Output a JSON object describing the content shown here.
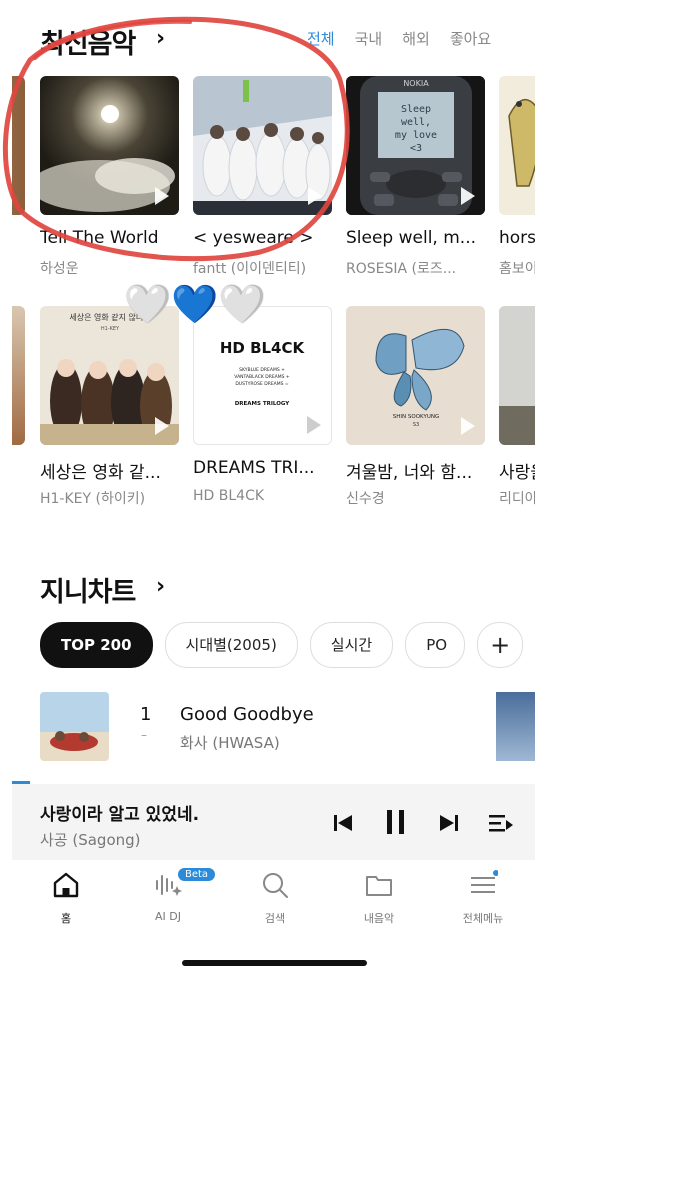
{
  "new_music": {
    "title": "최신음악",
    "tabs": [
      {
        "label": "전체",
        "active": true
      },
      {
        "label": "국내",
        "active": false
      },
      {
        "label": "해외",
        "active": false
      },
      {
        "label": "좋아요",
        "active": false
      }
    ],
    "row1": [
      {
        "title": "Tell The World",
        "artist": "하성운"
      },
      {
        "title": "< yesweare >",
        "artist": "fantt (이이덴티티)"
      },
      {
        "title": "Sleep well, m...",
        "artist": "ROSESIA (로즈..."
      },
      {
        "title": "hors",
        "artist": "홈보이"
      }
    ],
    "row2": [
      {
        "title": "세상은 영화 같...",
        "artist": "H1-KEY (하이키)"
      },
      {
        "title": "DREAMS TRI...",
        "artist": "HD BL4CK"
      },
      {
        "title": "겨울밤, 너와 함...",
        "artist": "신수경"
      },
      {
        "title": "사랑을",
        "artist": "리디아"
      }
    ],
    "cover_text": {
      "nokia_brand": "NOKIA",
      "sleep_screen": [
        "Sleep",
        "well,",
        "my love",
        "<3"
      ],
      "hikey_cover": "세상은 영화 같지 않더라",
      "hikey_small": "H1-KEY",
      "hdb_title": "HD BL4CK",
      "hdb_lines": [
        "SKYBLUE DREAMS +",
        "VANTABLACK DREAMS +",
        "DUSTYROSE DREAMS =",
        "DREAMS TRILOGY"
      ],
      "shin_cover": "SHIN SOOKYUNG",
      "shin_sub": "S3"
    }
  },
  "stickers": {
    "hearts": [
      "🤍",
      "💙",
      "🤍"
    ]
  },
  "genie_chart": {
    "title": "지니차트",
    "chips": [
      {
        "label": "TOP 200",
        "active": true
      },
      {
        "label": "시대별(2005)",
        "active": false
      },
      {
        "label": "실시간",
        "active": false
      },
      {
        "label": "PO",
        "active": false
      },
      {
        "label": "+",
        "active": false
      }
    ],
    "rows": [
      {
        "rank": "1",
        "change": "–",
        "title": "Good Goodbye",
        "artist": "화사 (HWASA)"
      }
    ]
  },
  "player": {
    "title": "사랑이라 알고 있었네.",
    "artist": "사공 (Sagong)"
  },
  "nav": {
    "items": [
      {
        "label": "홈",
        "active": true
      },
      {
        "label": "AI DJ",
        "badge": "Beta"
      },
      {
        "label": "검색"
      },
      {
        "label": "내음악"
      },
      {
        "label": "전체메뉴",
        "dot": true
      }
    ]
  },
  "colors": {
    "accent": "#2c8ad8",
    "annotation": "#e0453f",
    "active_chip": "#111111"
  }
}
